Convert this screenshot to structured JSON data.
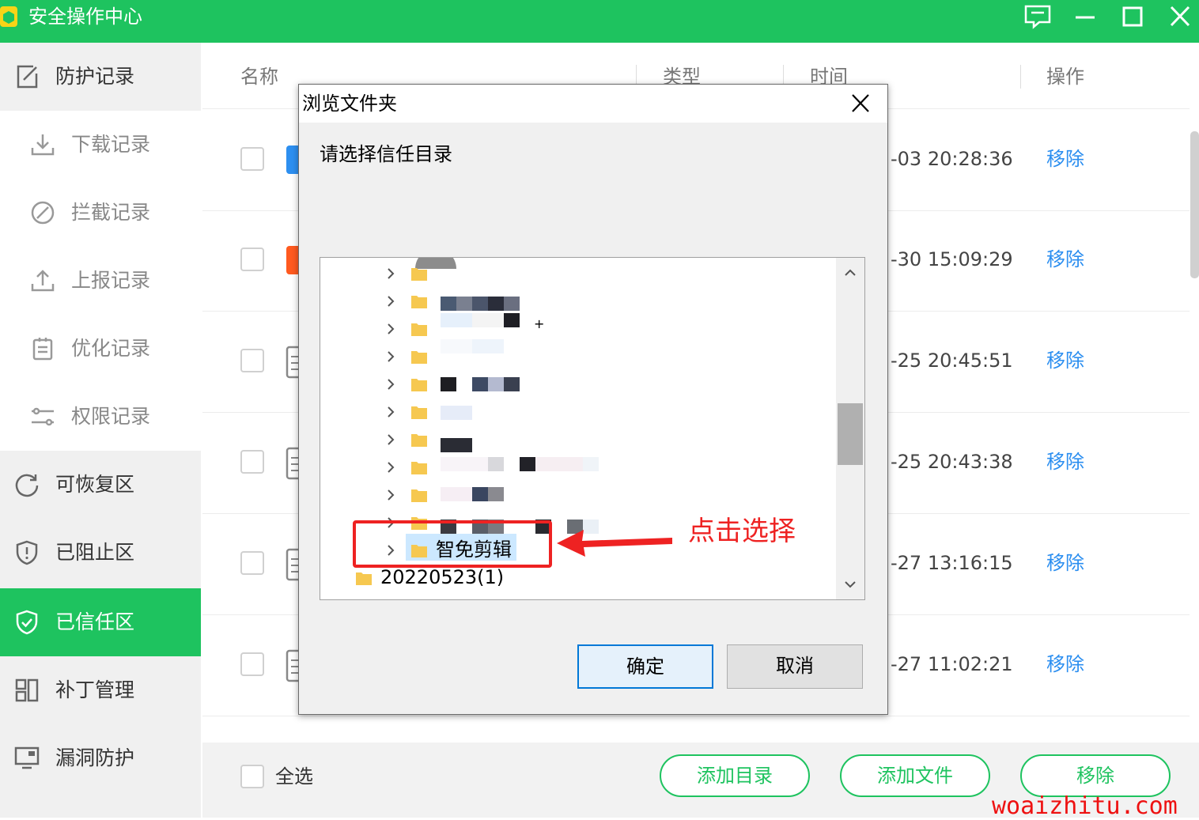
{
  "window": {
    "title": "安全操作中心"
  },
  "sidebar": {
    "items": [
      {
        "label": "防护记录",
        "icon": "edit-icon"
      },
      {
        "label": "下载记录",
        "icon": "download-icon"
      },
      {
        "label": "拦截记录",
        "icon": "block-icon"
      },
      {
        "label": "上报记录",
        "icon": "upload-icon"
      },
      {
        "label": "优化记录",
        "icon": "clipboard-icon"
      },
      {
        "label": "权限记录",
        "icon": "sliders-icon"
      },
      {
        "label": "可恢复区",
        "icon": "restore-icon"
      },
      {
        "label": "已阻止区",
        "icon": "shield-alert-icon"
      },
      {
        "label": "已信任区",
        "icon": "shield-check-icon"
      },
      {
        "label": "补丁管理",
        "icon": "grid-icon"
      },
      {
        "label": "漏洞防护",
        "icon": "monitor-icon"
      }
    ],
    "active_item": "已信任区"
  },
  "table": {
    "columns": {
      "name": "名称",
      "type": "类型",
      "time": "时间",
      "action": "操作"
    },
    "rows": [
      {
        "time": "-03 20:28:36",
        "action": "移除"
      },
      {
        "time": "-30 15:09:29",
        "action": "移除"
      },
      {
        "time": "-25 20:45:51",
        "action": "移除"
      },
      {
        "time": "-25 20:43:38",
        "action": "移除"
      },
      {
        "time": "-27 13:16:15",
        "action": "移除"
      },
      {
        "time": "-27 11:02:21",
        "action": "移除"
      }
    ]
  },
  "footer": {
    "select_all": "全选",
    "add_folder": "添加目录",
    "add_file": "添加文件",
    "remove": "移除"
  },
  "dialog": {
    "title": "浏览文件夹",
    "prompt": "请选择信任目录",
    "tree": {
      "selected_folder": "智免剪辑",
      "next_folder": "20220523(1)"
    },
    "ok": "确定",
    "cancel": "取消"
  },
  "annotation": {
    "text": "点击选择"
  },
  "watermark": "woaizhitu.com",
  "colors": {
    "brand_green": "#1ec35f",
    "link_blue": "#2b8ef0",
    "annotation_red": "#ee2222"
  }
}
